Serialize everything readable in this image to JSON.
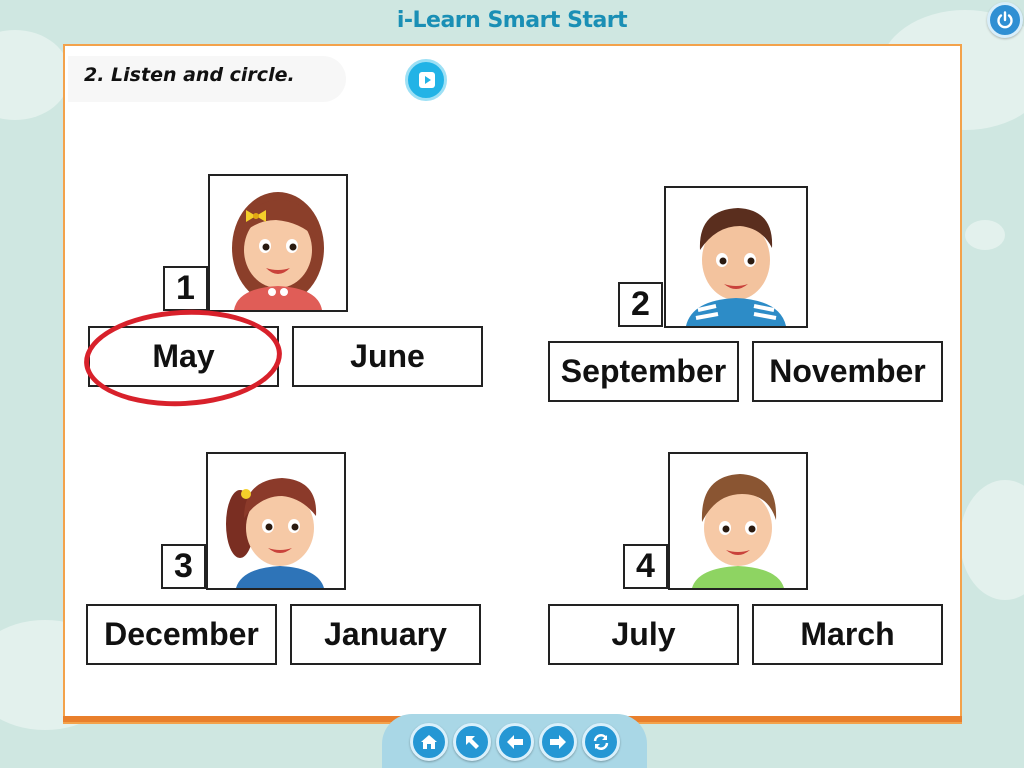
{
  "app": {
    "title": "i-Learn Smart Start"
  },
  "exercise": {
    "instruction": "2. Listen and circle.",
    "questions": [
      {
        "number": "1",
        "options": [
          "May",
          "June"
        ],
        "circled": "May",
        "person": "girl-with-bow"
      },
      {
        "number": "2",
        "options": [
          "September",
          "November"
        ],
        "circled": null,
        "person": "boy-striped-shirt"
      },
      {
        "number": "3",
        "options": [
          "December",
          "January"
        ],
        "circled": null,
        "person": "girl-ponytail"
      },
      {
        "number": "4",
        "options": [
          "July",
          "March"
        ],
        "circled": null,
        "person": "boy-green-shirt"
      }
    ]
  },
  "toolbar": {
    "icons": [
      "power-icon",
      "play-icon"
    ]
  },
  "nav": {
    "buttons": [
      "home-icon",
      "up-left-arrow-icon",
      "back-arrow-icon",
      "forward-arrow-icon",
      "refresh-icon"
    ]
  },
  "colors": {
    "accent": "#1a8fb5",
    "panel_border": "#f3a24b",
    "circle_mark": "#d8212b",
    "nav_button": "#2597d4"
  }
}
